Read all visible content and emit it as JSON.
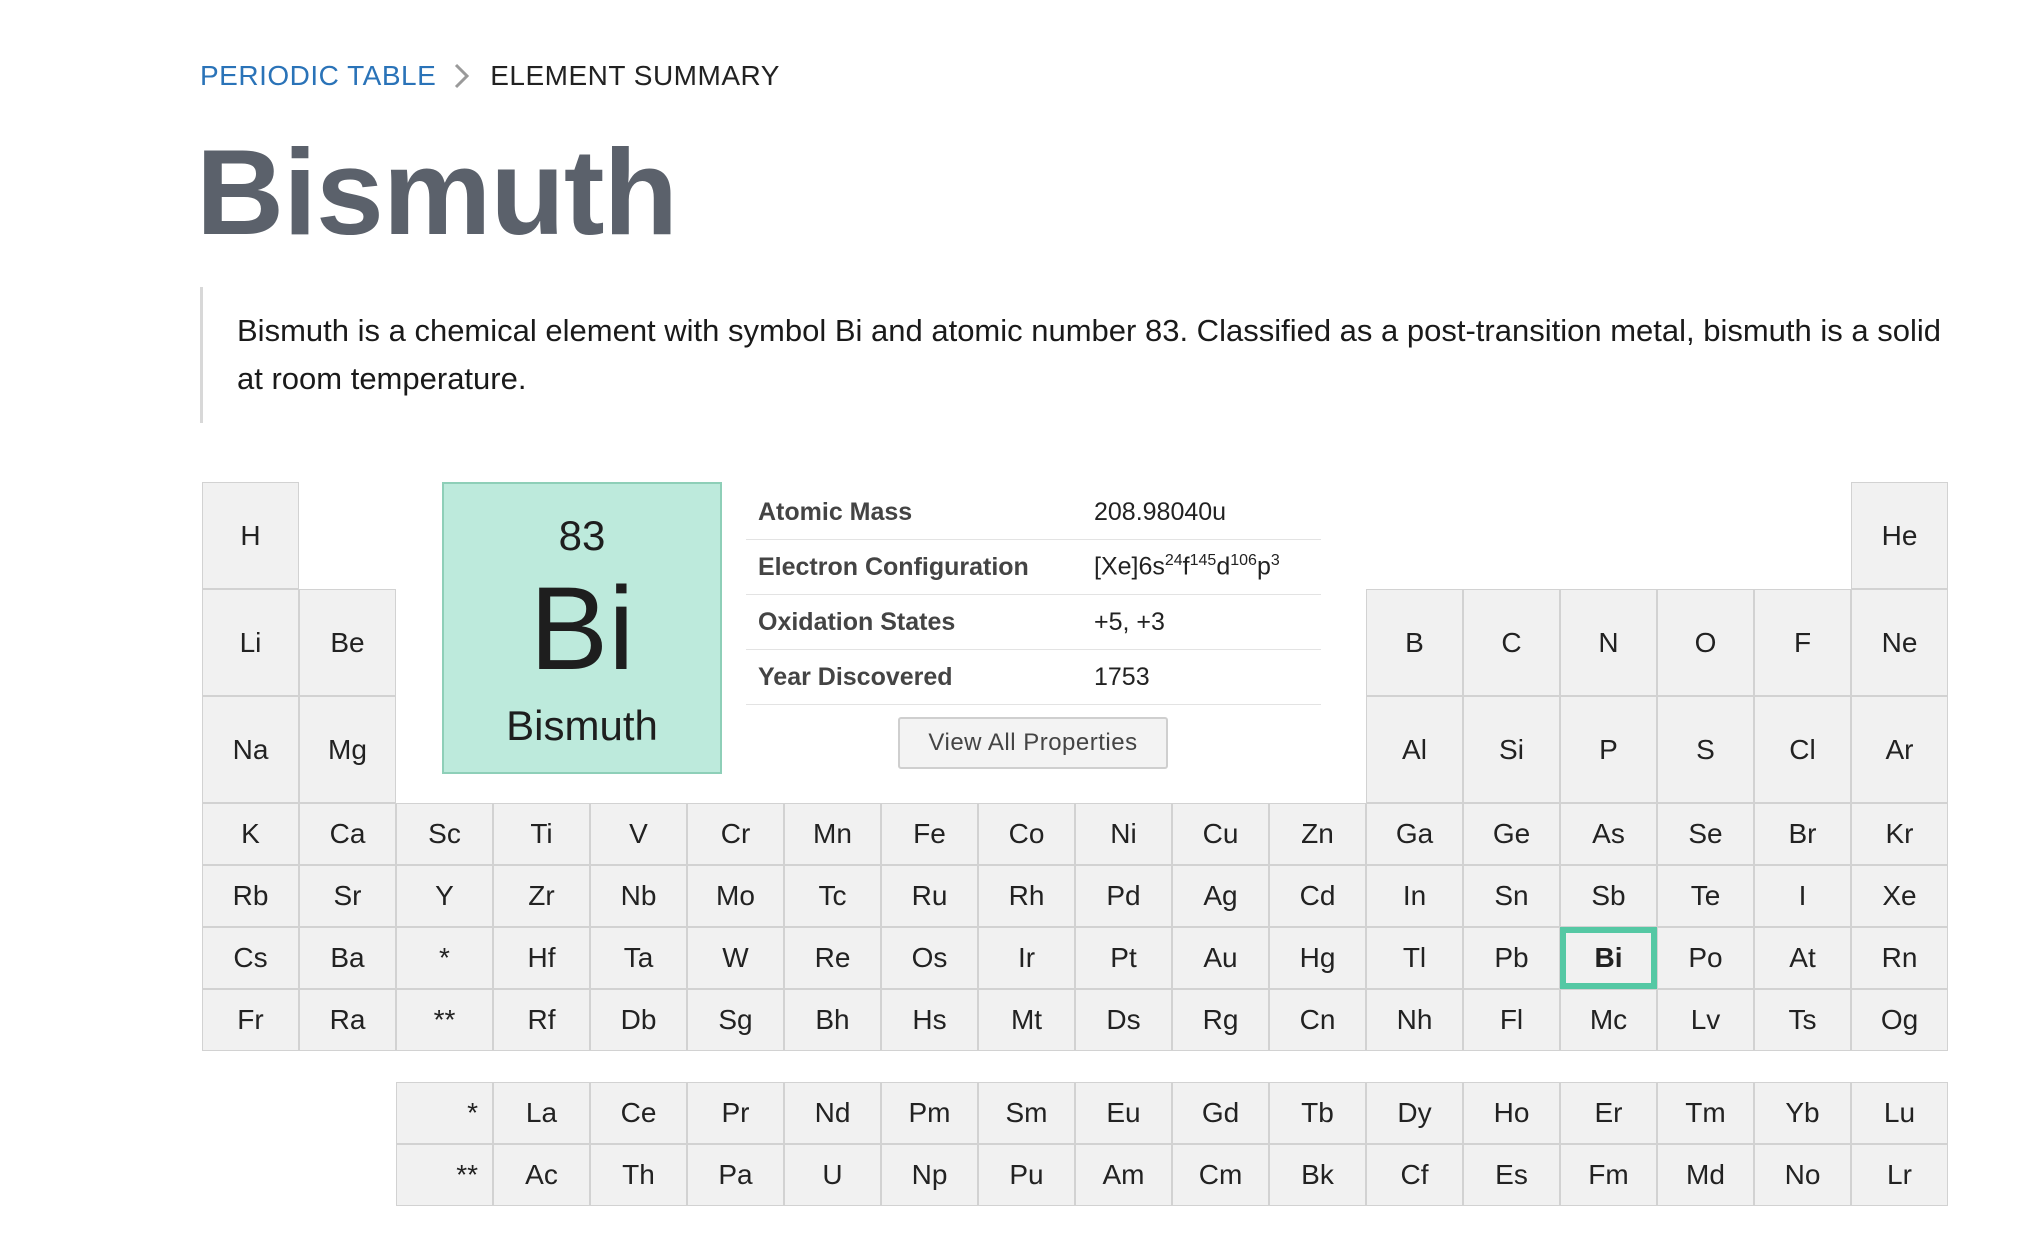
{
  "breadcrumb": {
    "root": "PERIODIC TABLE",
    "current": "ELEMENT SUMMARY"
  },
  "title": "Bismuth",
  "summary": "Bismuth is a chemical element with symbol Bi and atomic number 83. Classified as a post-transition metal, bismuth is a solid at room temperature.",
  "featured": {
    "number": "83",
    "symbol": "Bi",
    "name": "Bismuth",
    "color": "#bdeadc"
  },
  "properties": [
    {
      "key": "Atomic Mass",
      "value": "208.98040u"
    },
    {
      "key": "Electron Configuration",
      "value": "[Xe]6s24f145d106p3"
    },
    {
      "key": "Oxidation States",
      "value": "+5, +3"
    },
    {
      "key": "Year Discovered",
      "value": "1753"
    }
  ],
  "view_button": "View All Properties",
  "selected_symbol": "Bi",
  "selection_color": "#55c8a4",
  "rows": [
    [
      "H",
      "",
      "",
      "",
      "",
      "",
      "",
      "",
      "",
      "",
      "",
      "",
      "",
      "",
      "",
      "",
      "",
      "He"
    ],
    [
      "Li",
      "Be",
      "",
      "",
      "",
      "",
      "",
      "",
      "",
      "",
      "",
      "",
      "B",
      "C",
      "N",
      "O",
      "F",
      "Ne"
    ],
    [
      "Na",
      "Mg",
      "",
      "",
      "",
      "",
      "",
      "",
      "",
      "",
      "",
      "",
      "Al",
      "Si",
      "P",
      "S",
      "Cl",
      "Ar"
    ],
    [
      "K",
      "Ca",
      "Sc",
      "Ti",
      "V",
      "Cr",
      "Mn",
      "Fe",
      "Co",
      "Ni",
      "Cu",
      "Zn",
      "Ga",
      "Ge",
      "As",
      "Se",
      "Br",
      "Kr"
    ],
    [
      "Rb",
      "Sr",
      "Y",
      "Zr",
      "Nb",
      "Mo",
      "Tc",
      "Ru",
      "Rh",
      "Pd",
      "Ag",
      "Cd",
      "In",
      "Sn",
      "Sb",
      "Te",
      "I",
      "Xe"
    ],
    [
      "Cs",
      "Ba",
      "*",
      "Hf",
      "Ta",
      "W",
      "Re",
      "Os",
      "Ir",
      "Pt",
      "Au",
      "Hg",
      "Tl",
      "Pb",
      "Bi",
      "Po",
      "At",
      "Rn"
    ],
    [
      "Fr",
      "Ra",
      "**",
      "Rf",
      "Db",
      "Sg",
      "Bh",
      "Hs",
      "Mt",
      "Ds",
      "Rg",
      "Cn",
      "Nh",
      "Fl",
      "Mc",
      "Lv",
      "Ts",
      "Og"
    ]
  ],
  "f_block": [
    [
      "*",
      "La",
      "Ce",
      "Pr",
      "Nd",
      "Pm",
      "Sm",
      "Eu",
      "Gd",
      "Tb",
      "Dy",
      "Ho",
      "Er",
      "Tm",
      "Yb",
      "Lu"
    ],
    [
      "**",
      "Ac",
      "Th",
      "Pa",
      "U",
      "Np",
      "Pu",
      "Am",
      "Cm",
      "Bk",
      "Cf",
      "Es",
      "Fm",
      "Md",
      "No",
      "Lr"
    ]
  ]
}
